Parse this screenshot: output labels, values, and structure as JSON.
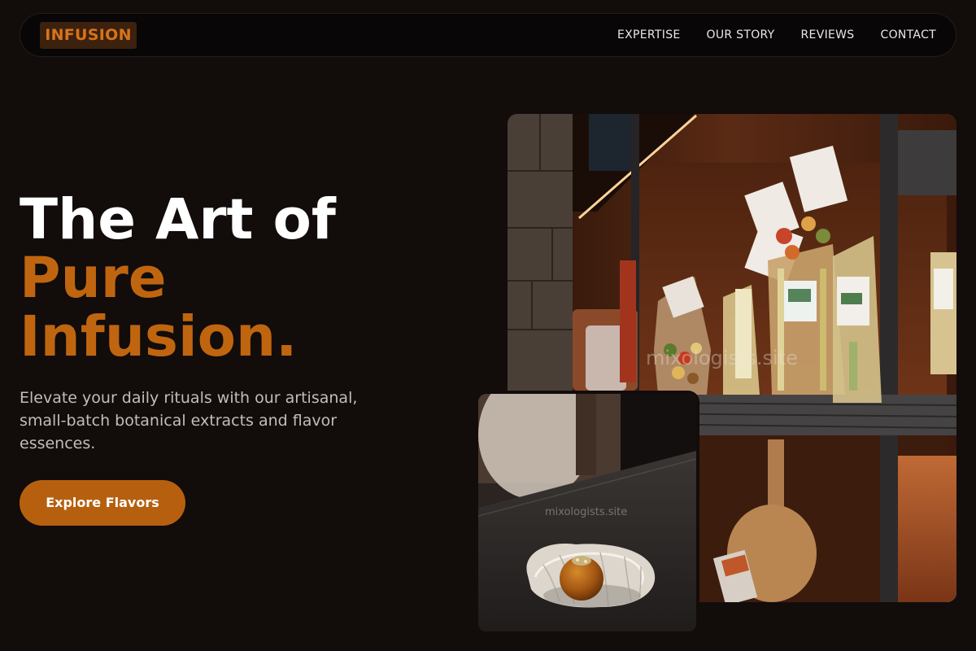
{
  "nav": {
    "logo": "INFUSION",
    "links": [
      "EXPERTISE",
      "OUR STORY",
      "REVIEWS",
      "CONTACT"
    ]
  },
  "hero": {
    "title_line1": "The Art of",
    "title_line2": "Pure",
    "title_line3": "Infusion.",
    "subtitle": "Elevate your daily rituals with our artisanal, small-batch botanical extracts and flavor essences.",
    "cta_label": "Explore Flavors"
  },
  "images": {
    "pantry_watermark": "mixologists.site",
    "dish_watermark": "mixologists.site"
  },
  "colors": {
    "background": "#120c0b",
    "accent": "#c0650f",
    "button": "#b6600f"
  }
}
